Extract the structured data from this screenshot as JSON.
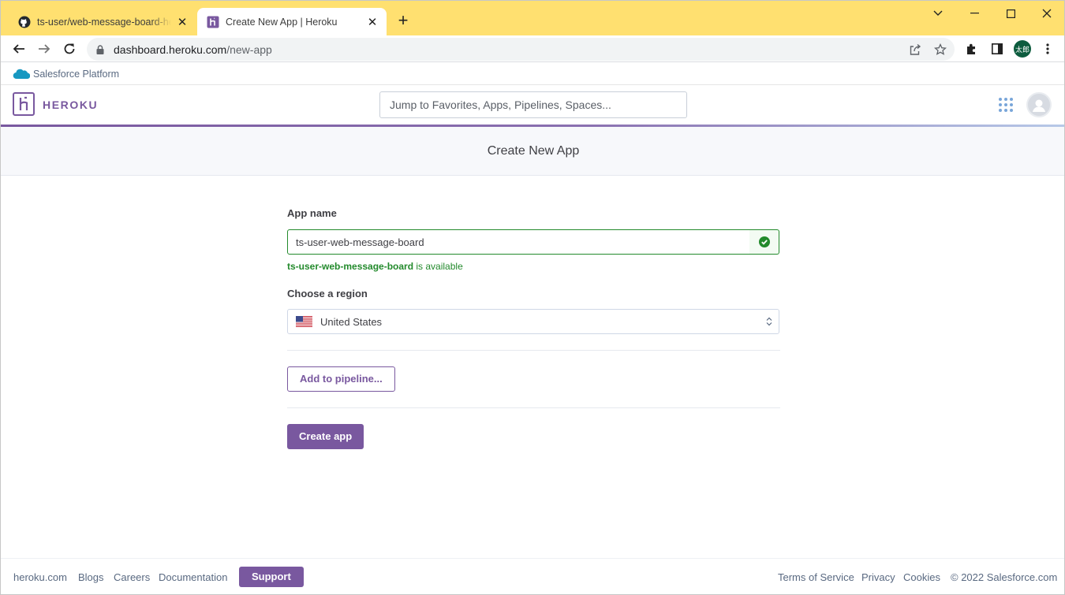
{
  "browser": {
    "tabs": [
      {
        "title": "ts-user/web-message-board-heroku",
        "favicon": "github-icon",
        "active": false
      },
      {
        "title": "Create New App | Heroku",
        "favicon": "heroku-icon",
        "active": true
      }
    ],
    "address": {
      "host": "dashboard.heroku.com",
      "path": "/new-app"
    },
    "profile_initials": "太郎"
  },
  "salesforce_bar": {
    "label": "Salesforce Platform"
  },
  "header": {
    "wordmark": "HEROKU",
    "search_placeholder": "Jump to Favorites, Apps, Pipelines, Spaces..."
  },
  "page": {
    "title": "Create New App"
  },
  "form": {
    "app_name_label": "App name",
    "app_name_value": "ts-user-web-message-board",
    "availability": {
      "name": "ts-user-web-message-board",
      "suffix": " is available"
    },
    "region_label": "Choose a region",
    "region_value": "United States",
    "pipeline_button": "Add to pipeline...",
    "create_button": "Create app"
  },
  "footer": {
    "links": [
      "heroku.com",
      "Blogs",
      "Careers",
      "Documentation"
    ],
    "support": "Support",
    "right_links": [
      "Terms of Service",
      "Privacy",
      "Cookies"
    ],
    "copyright": "© 2022 Salesforce.com"
  },
  "colors": {
    "tabstrip": "#ffe070",
    "heroku_purple": "#79589f",
    "success_green": "#238a2c"
  }
}
